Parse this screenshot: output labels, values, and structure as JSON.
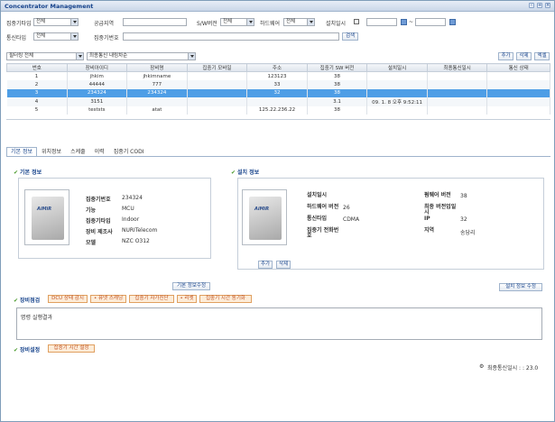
{
  "window": {
    "title": "Concentrator Management"
  },
  "filters": {
    "row1": {
      "type_label": "집중기타입",
      "type_value": "전체",
      "supply_label": "공급지역",
      "sw_label": "S/W버전",
      "sw_value": "전체",
      "hw_label": "하드웨어",
      "hw_value": "전체",
      "install_label": "설치일시",
      "range_sep": "~"
    },
    "row2": {
      "comm_label": "통신타입",
      "comm_value": "전체",
      "id_label": "집중기번호",
      "search_button": "검색"
    }
  },
  "toolbar": {
    "filter_value": "필터링 전체",
    "sort_value": "최종통신 내림차순",
    "add_button": "추가",
    "delete_button": "삭제",
    "excel_button": "엑셀"
  },
  "table": {
    "columns": [
      "번호",
      "장비아이디",
      "장비명",
      "집중기 모바일",
      "주소",
      "집중기 SW 버전",
      "설치일시",
      "최종통신일시",
      "통신 상태"
    ],
    "rows": [
      [
        "1",
        "jhkim",
        "jhkimname",
        "",
        "123123",
        "38",
        "",
        "",
        ""
      ],
      [
        "2",
        "44444",
        "777",
        "",
        "33",
        "38",
        "",
        "",
        ""
      ],
      [
        "3",
        "234324",
        "234324",
        "",
        "32",
        "38",
        "",
        "",
        ""
      ],
      [
        "4",
        "3151",
        "",
        "",
        "",
        "3.1",
        "09. 1. 8 오후 9:52:11",
        "",
        ""
      ],
      [
        "5",
        "teststs",
        "atat",
        "",
        "125.22.236.22",
        "38",
        "",
        "",
        ""
      ]
    ],
    "selected_row": 2
  },
  "tabs": [
    "기본 정보",
    "위치정보",
    "스케줄",
    "이력",
    "집중기 CODI"
  ],
  "basic": {
    "title": "기본 정보",
    "device_brand": "AiMiR",
    "fields": [
      {
        "k": "집중기번호",
        "v": "234324"
      },
      {
        "k": "기능",
        "v": "MCU"
      },
      {
        "k": "집중기타입",
        "v": "Indoor"
      },
      {
        "k": "장비 제조사",
        "v": "NURITelecom"
      },
      {
        "k": "모델",
        "v": "NZC O312"
      }
    ],
    "edit_button": "기본 정보수정"
  },
  "install": {
    "title": "설치 정보",
    "device_brand": "AiMiR",
    "fields_left": [
      {
        "k": "설치일시",
        "v": ""
      },
      {
        "k": "하드웨어 버전",
        "v": "26"
      },
      {
        "k": "통신타입",
        "v": "CDMA"
      },
      {
        "k": "집중기 전화번호",
        "v": ""
      }
    ],
    "fields_right": [
      {
        "k": "펌웨어 버전",
        "v": "38"
      },
      {
        "k": "최종 버전업일시",
        "v": ""
      },
      {
        "k": "IP",
        "v": "32"
      },
      {
        "k": "지역",
        "v": "송당리"
      }
    ],
    "add_button": "추가",
    "delete_button": "삭제",
    "edit_button": "설치 정보 수정"
  },
  "check": {
    "title": "장비점검",
    "buttons": [
      "DCU 상태 감시",
      "• 퓨넷 스캐닝",
      "집중기 자가진단",
      "• 리셋",
      "집중기 시간 동기화"
    ],
    "result_label": "명령 실행결과"
  },
  "settings": {
    "title": "장비설정",
    "button": "집중기 시간 설정"
  },
  "footer": {
    "last_comm": "최종통신일시 : : 23.0"
  }
}
